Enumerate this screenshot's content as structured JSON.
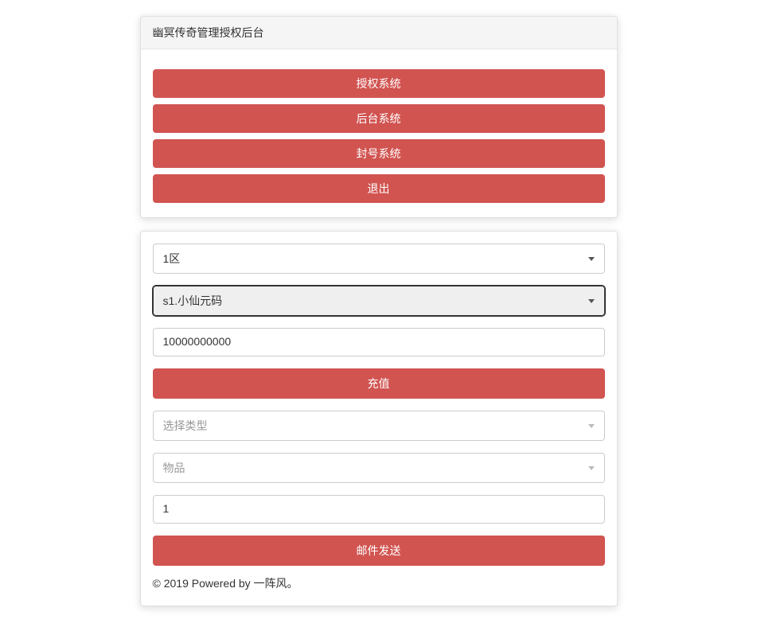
{
  "header": {
    "title": "幽冥传奇管理授权后台"
  },
  "nav": {
    "buttons": [
      {
        "label": "授权系统"
      },
      {
        "label": "后台系统"
      },
      {
        "label": "封号系统"
      },
      {
        "label": "退出"
      }
    ]
  },
  "form": {
    "zone_select": "1区",
    "server_select": "s1.小仙元码",
    "amount_value": "10000000000",
    "recharge_label": "充值",
    "type_select_placeholder": "选择类型",
    "item_select_placeholder": "物品",
    "quantity_value": "1",
    "send_label": "邮件发送"
  },
  "footer": {
    "text": "© 2019 Powered by 一阵风。"
  }
}
